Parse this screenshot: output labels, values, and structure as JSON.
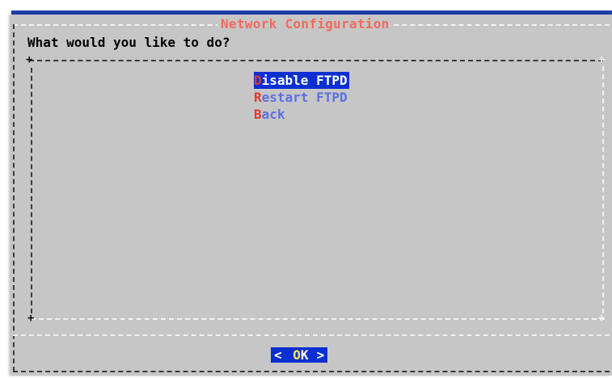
{
  "dialog": {
    "title": "Network Configuration",
    "prompt": "What would you like to do?",
    "menu": [
      {
        "hotkey": "D",
        "rest": "isable FTPD",
        "selected": true
      },
      {
        "hotkey": "R",
        "rest": "estart FTPD",
        "selected": false
      },
      {
        "hotkey": "B",
        "rest": "ack",
        "selected": false
      }
    ],
    "ok_button": {
      "left_bracket": "<",
      "hotkey": "O",
      "rest": "K",
      "right_bracket": ">"
    }
  },
  "colors": {
    "dialog_bg": "#c6c6c6",
    "title": "#f26a5a",
    "selection_bg": "#0b2fd1",
    "hotkey": "#e03a2a",
    "menu_text": "#5a6fe6",
    "top_bar": "#1f3fa8"
  }
}
